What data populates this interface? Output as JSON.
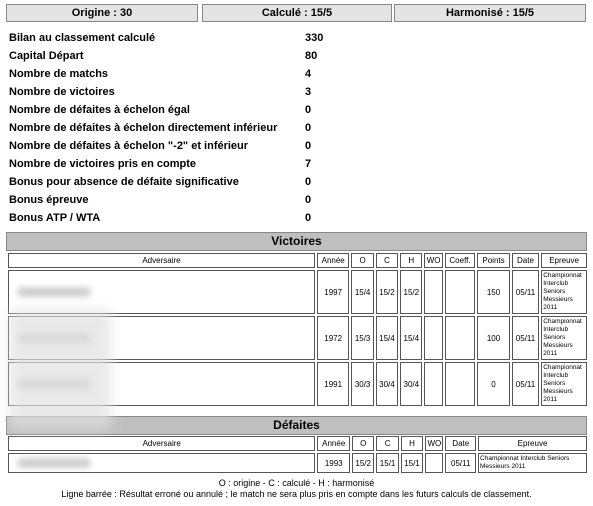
{
  "tabs": {
    "origine": "Origine : 30",
    "calcule": "Calculé : 15/5",
    "harmonise": "Harmonisé : 15/5"
  },
  "summary": [
    {
      "label": "Bilan au classement calculé",
      "value": "330"
    },
    {
      "label": "Capital Départ",
      "value": "80"
    },
    {
      "label": "Nombre de matchs",
      "value": "4"
    },
    {
      "label": "Nombre de victoires",
      "value": "3"
    },
    {
      "label": "Nombre de défaites à échelon égal",
      "value": "0"
    },
    {
      "label": "Nombre de défaites à échelon directement inférieur",
      "value": "0"
    },
    {
      "label": "Nombre de défaites à échelon \"-2\" et inférieur",
      "value": "0"
    },
    {
      "label": "Nombre de victoires pris en compte",
      "value": "7"
    },
    {
      "label": "Bonus pour absence de défaite significative",
      "value": "0"
    },
    {
      "label": "Bonus épreuve",
      "value": "0"
    },
    {
      "label": "Bonus ATP / WTA",
      "value": "0"
    }
  ],
  "victoires": {
    "title": "Victoires",
    "headers": [
      "Adversaire",
      "Année",
      "O",
      "C",
      "H",
      "WO",
      "Coeff.",
      "Points",
      "Date",
      "Epreuve"
    ],
    "rows": [
      {
        "annee": "1997",
        "o": "15/4",
        "c": "15/2",
        "h": "15/2",
        "wo": "",
        "coeff": "",
        "points": "150",
        "date": "05/11",
        "epreuve": "Championnat Interclub Seniors Messieurs 2011"
      },
      {
        "annee": "1972",
        "o": "15/3",
        "c": "15/4",
        "h": "15/4",
        "wo": "",
        "coeff": "",
        "points": "100",
        "date": "05/11",
        "epreuve": "Championnat Interclub Seniors Messieurs 2011"
      },
      {
        "annee": "1991",
        "o": "30/3",
        "c": "30/4",
        "h": "30/4",
        "wo": "",
        "coeff": "",
        "points": "0",
        "date": "05/11",
        "epreuve": "Championnat Interclub Seniors Messieurs 2011"
      }
    ]
  },
  "defaites": {
    "title": "Défaites",
    "headers": [
      "Adversaire",
      "Année",
      "O",
      "C",
      "H",
      "WO",
      "Date",
      "Epreuve"
    ],
    "rows": [
      {
        "annee": "1993",
        "o": "15/2",
        "c": "15/1",
        "h": "15/1",
        "wo": "",
        "date": "05/11",
        "epreuve": "Championnat Interclub Seniors Messieurs 2011"
      }
    ]
  },
  "legend": "O : origine - C : calculé - H : harmonisé",
  "note": "Ligne barrée : Résultat erroné ou annulé ; le match ne sera plus pris en compte dans les futurs calculs de classement."
}
